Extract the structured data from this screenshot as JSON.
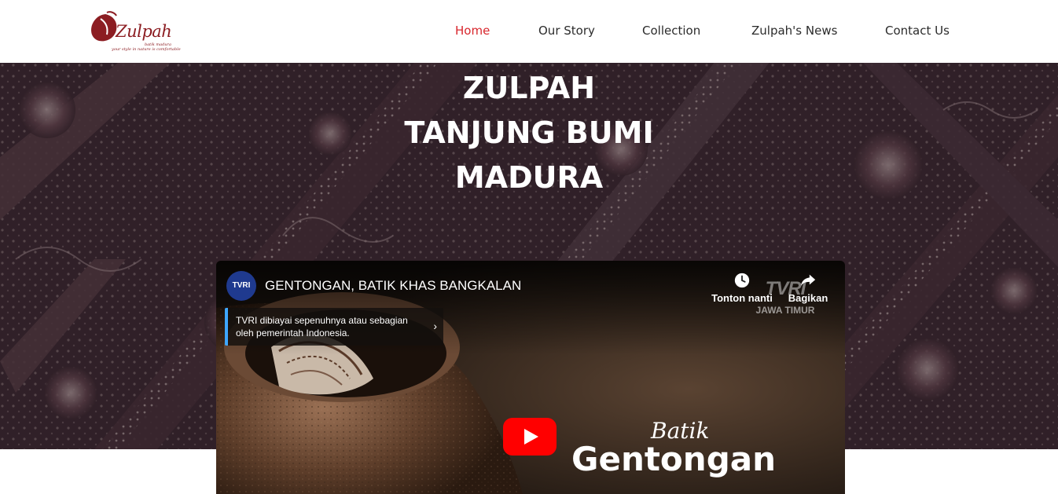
{
  "header": {
    "logo": {
      "word": "Zulpah",
      "sub": "batik madura",
      "tagline": "your style in nature is comfortable"
    },
    "nav": [
      {
        "label": "Home",
        "active": true
      },
      {
        "label": "Our Story",
        "active": false
      },
      {
        "label": "Collection",
        "active": false
      },
      {
        "label": "Zulpah's News",
        "active": false
      },
      {
        "label": "Contact Us",
        "active": false
      }
    ]
  },
  "hero": {
    "title_lines": [
      "ZULPAH",
      "TANJUNG BUMI",
      "MADURA"
    ]
  },
  "video": {
    "channel_avatar": "TVRI",
    "title": "GENTONGAN, BATIK KHAS BANGKALAN",
    "watch_later": "Tonton nanti",
    "share": "Bagikan",
    "watermark_brand": "TVRI",
    "watermark_region": "JAWA TIMUR",
    "info_card": "TVRI dibiayai sepenuhnya atau sebagian oleh pemerintah Indonesia.",
    "overlay_script": "Batik",
    "overlay_big": "Gentongan",
    "icons": {
      "watch_later": "clock-icon",
      "share": "share-arrow-icon",
      "info_chevron": "chevron-right-icon",
      "play": "youtube-play-icon"
    }
  },
  "colors": {
    "accent": "#d8262c",
    "brand": "#8c1d22",
    "youtube_red": "#ff0000",
    "info_bar": "#3ea6ff"
  }
}
